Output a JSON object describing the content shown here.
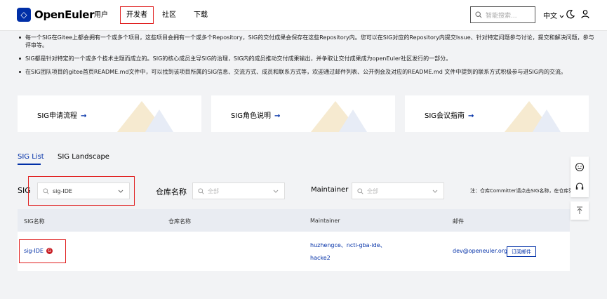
{
  "header": {
    "logo_text": "OpenEuler",
    "nav": [
      {
        "label": "用户"
      },
      {
        "label": "开发者"
      },
      {
        "label": "社区"
      },
      {
        "label": "下载"
      }
    ],
    "search_placeholder": "智能搜索...",
    "language": "中文",
    "icons": [
      "search-icon",
      "chevron-down-icon",
      "moon-icon",
      "user-icon"
    ]
  },
  "notes": [
    "每一个SIG在Gitee上都会拥有一个或多个项目，这些项目会拥有一个或多个Repository，SIG的交付成果会保存在这些Repository内。您可以在SIG对应的Repository内提交Issue、针对特定问题参与讨论，提交和解决问题，参与评审等。",
    "SIG都是针对特定的一个或多个技术主题而成立的。SIG的核心成员主导SIG的治理，SIG内的成员推动交付成果输出，并争取让交付成果成为openEuler社区发行的一部分。",
    "在SIG团队项目的gitee首页README.md文件中，可以找到该项目所属的SIG信息、交流方式、成员和联系方式等，欢迎通过邮件列表、公开例会及对应的README.md 文件中提到的联系方式积极参与进SIG内的交流。"
  ],
  "cards": [
    {
      "label": "SIG申请流程",
      "arrow": "→"
    },
    {
      "label": "SIG角色说明",
      "arrow": "→"
    },
    {
      "label": "SIG会议指南",
      "arrow": "→"
    }
  ],
  "tabs": [
    {
      "label": "SIG List",
      "active": true
    },
    {
      "label": "SIG Landscape",
      "active": false
    }
  ],
  "filters": {
    "sig_label": "SIG",
    "sig_value": "sig-IDE",
    "repo_label": "仓库名称",
    "repo_placeholder": "全部",
    "maintainer_label": "Maintainer",
    "maintainer_placeholder": "全部",
    "note": "注：仓库Committer请点击SIG名称，在仓库列表中查看"
  },
  "table": {
    "headers": [
      "SIG名称",
      "仓库名称",
      "Maintainer",
      "邮件"
    ],
    "row": {
      "sig": "sig-IDE",
      "maintainers_line1": "huzhengce、ncti-gba-ide、",
      "maintainers_line2": "hacke2",
      "email": "dev@openeuler.org",
      "subscribe": "订阅邮件"
    }
  },
  "colors": {
    "brand": "#002fa7",
    "highlight": "#e02020",
    "background": "#f2f3f5"
  }
}
